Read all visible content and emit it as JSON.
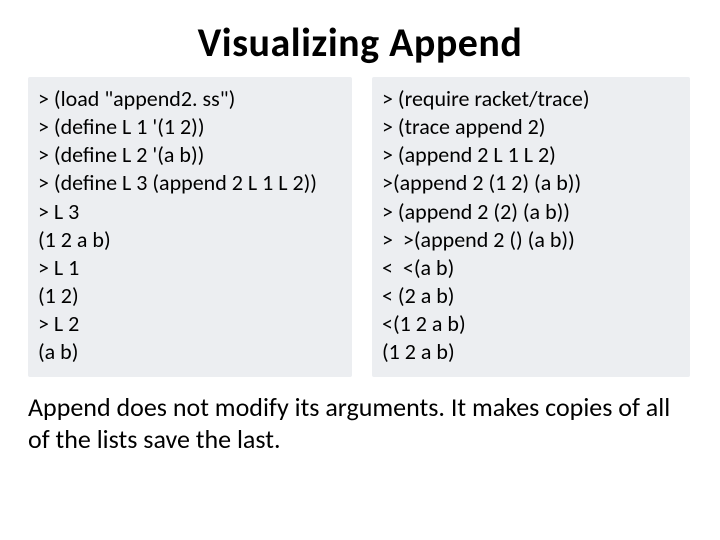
{
  "title": "Visualizing Append",
  "left": {
    "l0": "> (load \"append2. ss\")",
    "l1": "> (define L 1 '(1 2))",
    "l2": "> (define L 2 '(a b))",
    "l3": "> (define L 3 (append 2 L 1 L 2))",
    "l4": "> L 3",
    "l5": "(1 2 a b)",
    "l6": "> L 1",
    "l7": "(1 2)",
    "l8": "> L 2",
    "l9": "(a b)"
  },
  "right": {
    "l0": "> (require racket/trace)",
    "l1": "> (trace append 2)",
    "l2": "> (append 2 L 1 L 2)",
    "l3": ">(append 2 (1 2) (a b))",
    "l4": "> (append 2 (2) (a b))",
    "l5": ">  >(append 2 () (a b))",
    "l6": "<  <(a b)",
    "l7": "< (2 a b)",
    "l8": "<(1 2 a b)",
    "l9": "(1 2 a b)"
  },
  "note": "Append does not modify its arguments.  It makes copies of all of the lists save the last."
}
